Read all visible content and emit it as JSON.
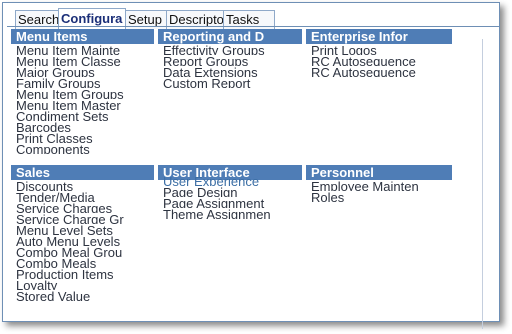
{
  "tabs": [
    {
      "label": "Search",
      "active": false
    },
    {
      "label": "Configura",
      "active": true
    },
    {
      "label": "Setup",
      "active": false
    },
    {
      "label": "Descripto",
      "active": false
    },
    {
      "label": "Tasks",
      "active": false
    }
  ],
  "sections": {
    "menu_items": {
      "title": "Menu Items",
      "items": [
        "Menu Item Mainte",
        "Menu Item Classe",
        "Major Groups",
        "Family Groups",
        "Menu Item Groups",
        "Menu Item Master",
        "Condiment Sets",
        "Barcodes",
        "Print Classes",
        "Components"
      ]
    },
    "reporting": {
      "title": "Reporting and D",
      "items": [
        "Effectivity Groups",
        "Report Groups",
        "Data Extensions",
        "Custom Report"
      ]
    },
    "enterprise": {
      "title": "Enterprise Infor",
      "items": [
        "Print Logos",
        "RC Autosequence",
        "RC Autosequence"
      ]
    },
    "sales": {
      "title": "Sales",
      "items": [
        "Discounts",
        "Tender/Media",
        "Service Charges",
        "Service Charge Gr",
        "Menu Level Sets",
        "Auto Menu Levels",
        "Combo Meal Grou",
        "Combo Meals",
        "Production Items",
        "Loyalty",
        "Stored Value"
      ]
    },
    "user_interface": {
      "title": "User Interface",
      "items": [
        "User Experience",
        "Page Design",
        "Page Assignment",
        "Theme Assignmen"
      ]
    },
    "personnel": {
      "title": "Personnel",
      "items": [
        "Employee Mainten",
        "Roles"
      ]
    }
  }
}
